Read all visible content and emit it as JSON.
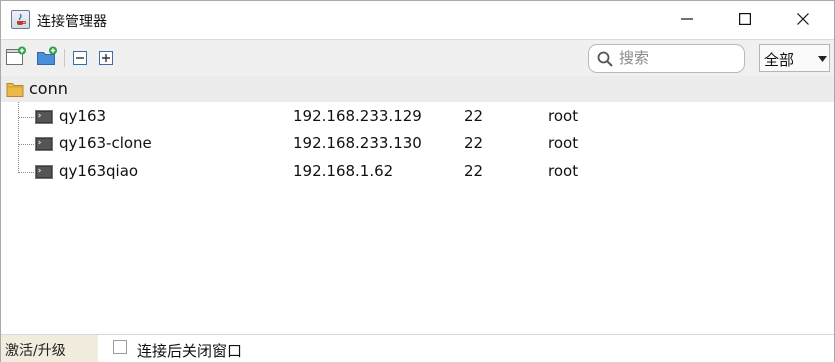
{
  "window": {
    "title": "连接管理器"
  },
  "toolbar": {
    "buttons": [
      "new-connection",
      "new-folder",
      "collapse-all",
      "expand-all"
    ],
    "search_placeholder": "搜索",
    "scope_selected": "全部"
  },
  "tree": {
    "group": {
      "label": "conn"
    },
    "connections": [
      {
        "name": "qy163",
        "host": "192.168.233.129",
        "port": "22",
        "user": "root"
      },
      {
        "name": "qy163-clone",
        "host": "192.168.233.130",
        "port": "22",
        "user": "root"
      },
      {
        "name": "qy163qiao",
        "host": "192.168.1.62",
        "port": "22",
        "user": "root"
      }
    ]
  },
  "statusbar": {
    "activate_label": "激活/升级",
    "close_after_connect_label": "连接后关闭窗口",
    "close_after_connect_checked": false
  }
}
